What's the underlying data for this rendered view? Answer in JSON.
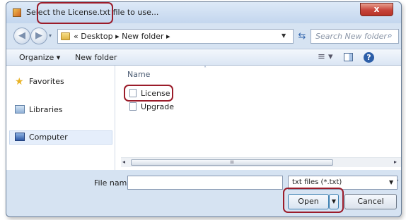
{
  "window": {
    "title": "Select the License.txt file to use...",
    "close_label": "x"
  },
  "navigation": {
    "back_glyph": "◀",
    "forward_glyph": "▶",
    "dropdown_glyph": "▾",
    "address_path": "«  Desktop  ▸  New folder  ▸",
    "address_dropdown_glyph": "▼",
    "refresh_glyph": "⇆",
    "search_placeholder": "Search New folder",
    "search_glyph": "⌕"
  },
  "toolbar": {
    "organize_label": "Organize ▾",
    "new_folder_label": "New folder",
    "views_glyph": "≡ ▾",
    "help_label": "?"
  },
  "nav_pane": {
    "items": [
      {
        "label": "Favorites",
        "icon": "star-icon"
      },
      {
        "label": "Libraries",
        "icon": "libraries-icon"
      },
      {
        "label": "Computer",
        "icon": "computer-icon"
      }
    ]
  },
  "file_list": {
    "column_name": "Name",
    "sort_glyph": "˄",
    "files": [
      {
        "name": "License",
        "icon": "text-document-icon"
      },
      {
        "name": "Upgrade",
        "icon": "text-document-icon"
      }
    ],
    "scroll_left_glyph": "◂",
    "scroll_right_glyph": "▸",
    "scroll_grip": "III"
  },
  "footer": {
    "file_name_label": "File name:",
    "file_name_value": "",
    "file_name_dropdown_glyph": "▼",
    "file_type_value": "txt files (*.txt)",
    "file_type_dropdown_glyph": "▼",
    "open_label": "Open",
    "open_split_glyph": "▼",
    "cancel_label": "Cancel"
  },
  "colors": {
    "highlight": "#9b1c2a",
    "window_frame": "#d6e3f2",
    "close_button": "#c7443a"
  }
}
